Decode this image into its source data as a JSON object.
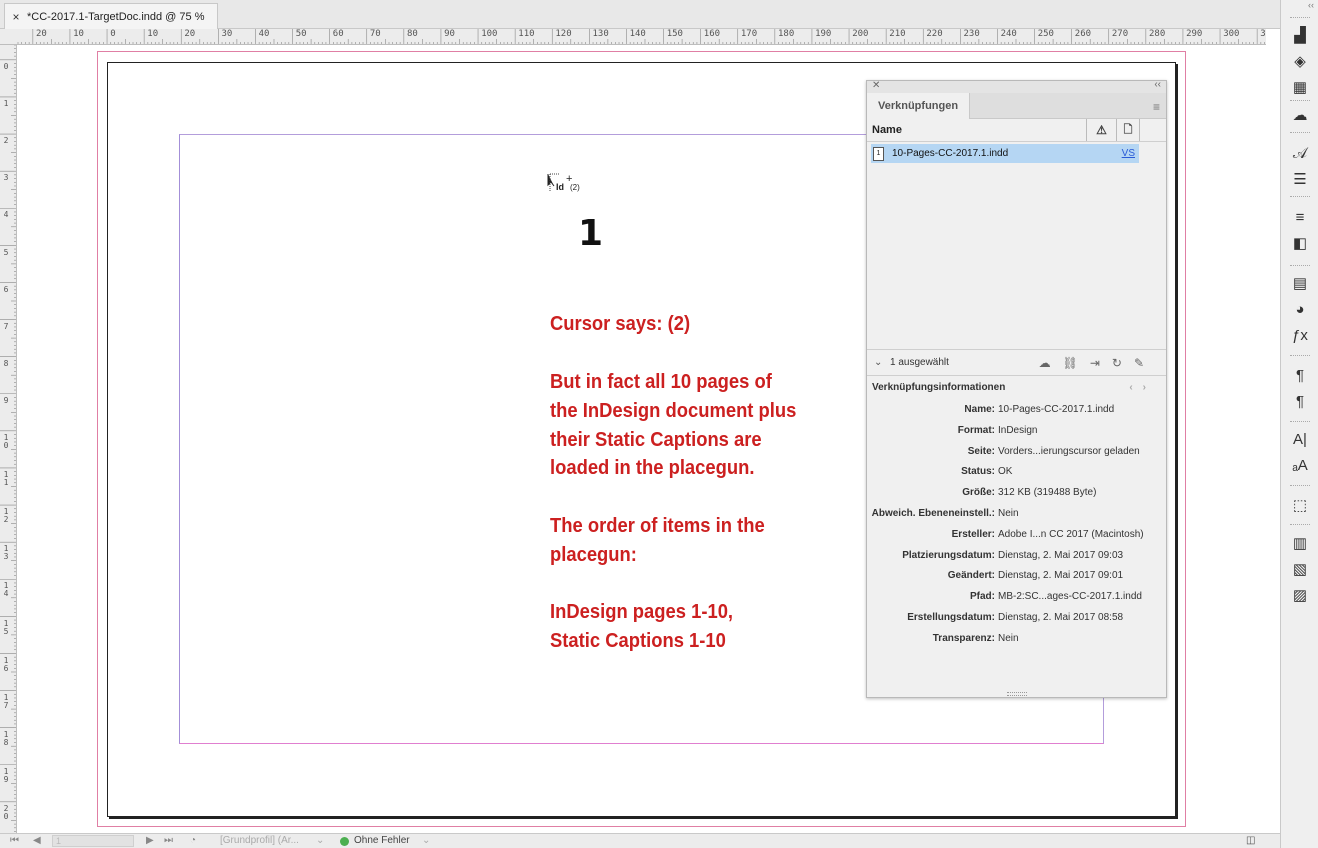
{
  "document_tab": {
    "close_glyph": "×",
    "title": "*CC-2017.1-TargetDoc.indd @ 75 %"
  },
  "ruler": {
    "horizontal_labels": [
      "20",
      "10",
      "0",
      "10",
      "20",
      "30",
      "40",
      "50",
      "60",
      "70",
      "80",
      "90",
      "100",
      "110",
      "120",
      "130",
      "140",
      "150",
      "160",
      "170",
      "180",
      "190",
      "200",
      "210",
      "220",
      "230",
      "240",
      "250",
      "260",
      "270",
      "280",
      "290",
      "300",
      "310",
      "3"
    ],
    "vertical_labels": [
      "0",
      "1",
      "2",
      "3",
      "4",
      "5",
      "6",
      "7",
      "8",
      "9",
      "10",
      "11",
      "12",
      "13",
      "14",
      "15",
      "16",
      "17",
      "18",
      "19",
      "20"
    ]
  },
  "page": {
    "cursor": {
      "id_label": "Id",
      "count": "(2)",
      "plus": "+"
    },
    "page_number": "1",
    "annotation_lines": [
      "Cursor says: (2)",
      "But in fact all 10 pages of",
      "the InDesign document plus",
      "their Static Captions are",
      "loaded in the placegun.",
      "The order of items in the",
      "placegun:",
      "InDesign pages 1-10,",
      "Static Captions 1-10"
    ]
  },
  "links_panel": {
    "tab_label": "Verknüpfungen",
    "column_name": "Name",
    "link": {
      "page_icon": "1",
      "file_name": "10-Pages-CC-2017.1.indd",
      "version": "VS"
    },
    "selection_text": "1 ausgewählt",
    "info_title": "Verknüpfungsinformationen",
    "info": [
      {
        "key": "Name:",
        "value": "10-Pages-CC-2017.1.indd"
      },
      {
        "key": "Format:",
        "value": "InDesign"
      },
      {
        "key": "Seite:",
        "value": "Vorders...ierungscursor geladen"
      },
      {
        "key": "Status:",
        "value": "OK"
      },
      {
        "key": "Größe:",
        "value": "312 KB (319488 Byte)"
      },
      {
        "key": "Abweich. Ebeneneinstell.:",
        "value": "Nein"
      },
      {
        "key": "Ersteller:",
        "value": "Adobe I...n CC 2017 (Macintosh)"
      },
      {
        "key": "Platzierungsdatum:",
        "value": "Dienstag, 2. Mai 2017 09:03"
      },
      {
        "key": "Geändert:",
        "value": "Dienstag, 2. Mai 2017 09:01"
      },
      {
        "key": "Pfad:",
        "value": "MB-2:SC...ages-CC-2017.1.indd"
      },
      {
        "key": "Erstellungsdatum:",
        "value": "Dienstag, 2. Mai 2017 08:58"
      },
      {
        "key": "Transparenz:",
        "value": "Nein"
      }
    ]
  },
  "statusbar": {
    "page_field": "1",
    "profile": "[Grundprofil] (Ar...",
    "preflight": "Ohne Fehler"
  },
  "colors": {
    "annotation": "#cc2020",
    "bleed": "#e07fa4",
    "margin": "#b39ddb",
    "selected_row": "#b5d6f3",
    "preflight_ok": "#4caf50"
  }
}
